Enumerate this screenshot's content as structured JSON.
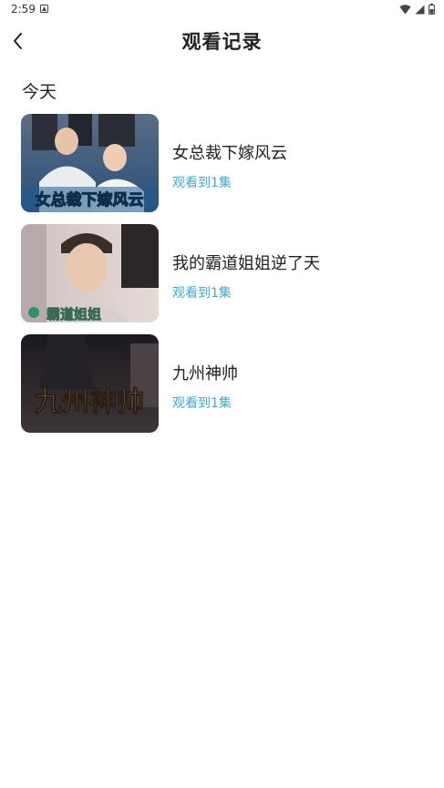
{
  "status_bar": {
    "time": "2:59"
  },
  "header": {
    "title": "观看记录"
  },
  "section": {
    "title": "今天"
  },
  "items": [
    {
      "title": "女总裁下嫁风云",
      "progress": "观看到1集",
      "thumb_caption": "女总裁下嫁风云"
    },
    {
      "title": "我的霸道姐姐逆了天",
      "progress": "观看到1集",
      "thumb_caption": "霸道姐姐"
    },
    {
      "title": "九州神帅",
      "progress": "观看到1集",
      "thumb_caption": "九州神帅"
    }
  ],
  "colors": {
    "accent": "#3fa9d1",
    "text_primary": "#222222",
    "background": "#ffffff"
  }
}
